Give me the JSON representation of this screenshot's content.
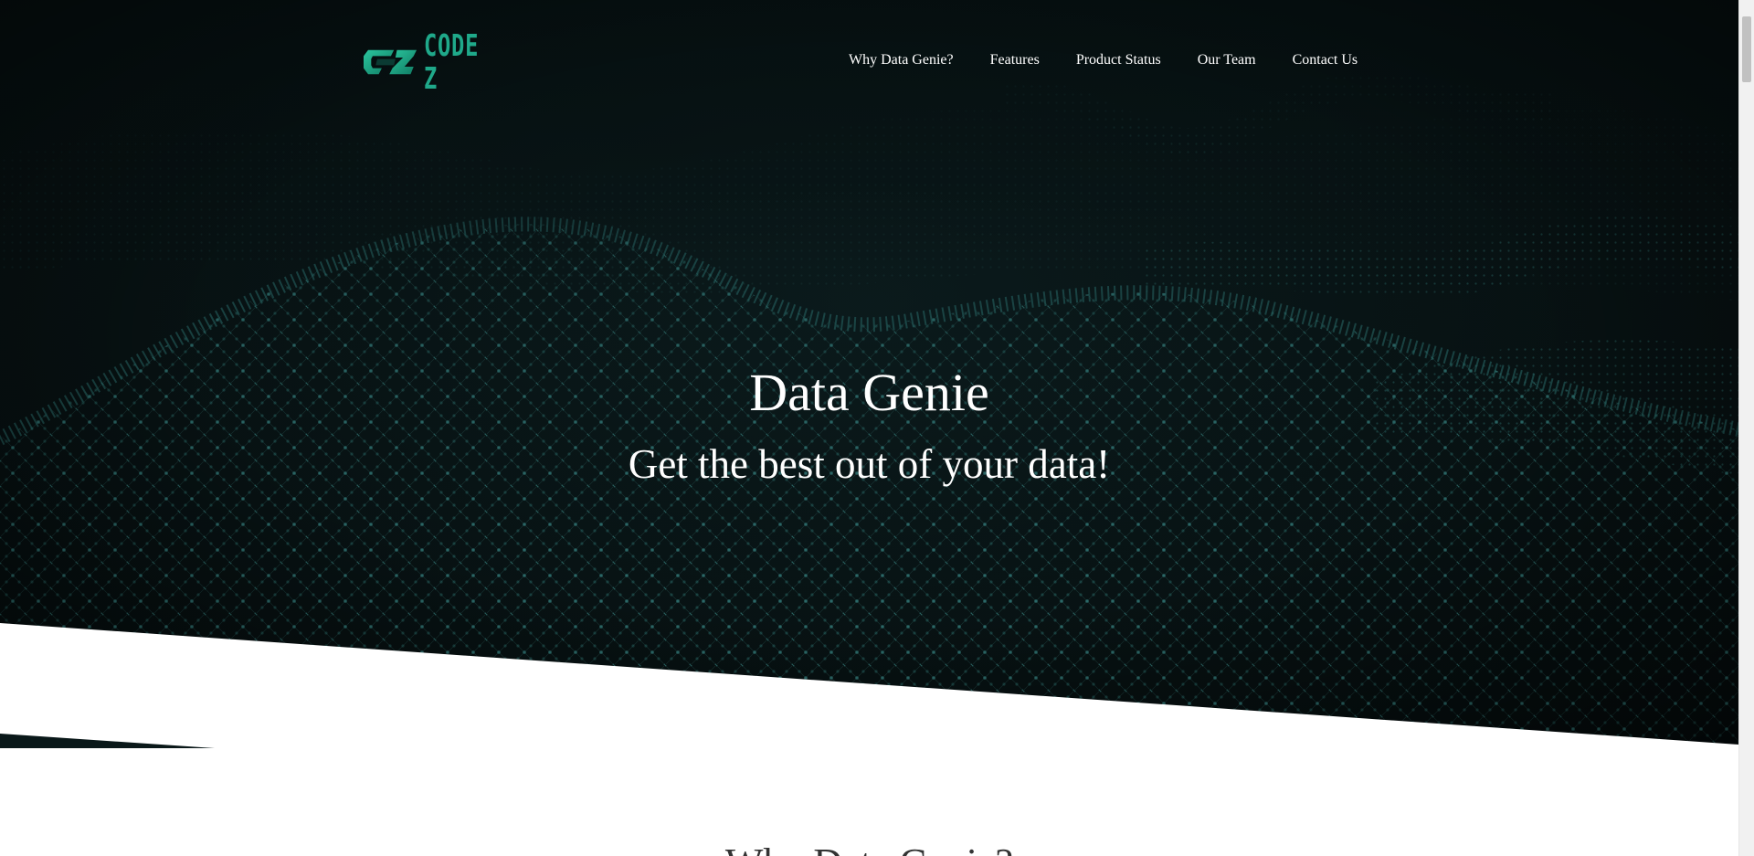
{
  "brand": {
    "name": "CODE Z",
    "accent_color": "#1fa98a"
  },
  "nav": {
    "items": [
      {
        "label": "Why Data Genie?"
      },
      {
        "label": "Features"
      },
      {
        "label": "Product Status"
      },
      {
        "label": "Our Team"
      },
      {
        "label": "Contact Us"
      }
    ]
  },
  "hero": {
    "title": "Data Genie",
    "subtitle": "Get the best out of your data!",
    "background_color": "#071112",
    "wave_color": "#2a6b6b"
  },
  "section": {
    "heading": "Why Data Genie?"
  }
}
